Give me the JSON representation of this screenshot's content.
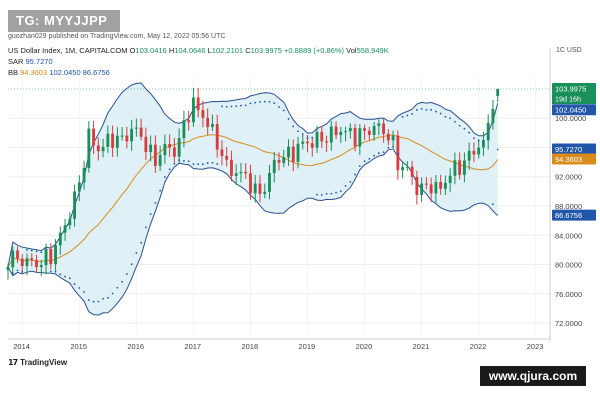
{
  "badge": "TG: MYYJJPP",
  "published": "guozhan029 published on TradingView.com, May 12, 2022 05:56 UTC",
  "header": {
    "symbol": "US Dollar Index, 1M, CAPITALCOM",
    "open_label": "O",
    "open": "103.0416",
    "high_label": "H",
    "high": "104.0646",
    "low_label": "L",
    "low": "102.2101",
    "close_label": "C",
    "close": "103.9975",
    "change": "+0.8889 (+0.86%)",
    "vol_label": "Vol",
    "vol": "558.949K",
    "sar_label": "SAR",
    "sar": "95.7270",
    "bb_label": "BB",
    "bb_mid": "94.3603",
    "bb_upper": "102.0450",
    "bb_lower": "86.6756"
  },
  "currency": "1C USD",
  "price_tags": {
    "close": "103.9975",
    "countdown": "19d 16h",
    "bb_upper": "102.0450",
    "sar": "95.7270",
    "bb_mid": "94.3603",
    "bb_lower": "86.6756"
  },
  "colors": {
    "up": "#1a8f5a",
    "down": "#d93c3c",
    "sar": "#2156a8",
    "bb_mid": "#d98b1c",
    "bb_band": "#2b4f8c",
    "bb_fill": "#dff0f6",
    "close_tag": "#1a8f5a",
    "upper_tag": "#2156a8",
    "sar_tag": "#2156a8",
    "mid_tag": "#d98b1c"
  },
  "footer": {
    "tradingview": "TradingView",
    "logo_icon": "tradingview-logo-icon"
  },
  "watermark": "www.qjura.com",
  "chart_data": {
    "type": "candlestick",
    "title": "US Dollar Index, 1M, CAPITALCOM",
    "x_ticks": [
      "2014",
      "2015",
      "2016",
      "2017",
      "2018",
      "2019",
      "2020",
      "2021",
      "2022",
      "2023"
    ],
    "y_ticks": [
      "72.0000",
      "76.0000",
      "80.0000",
      "84.0000",
      "88.0000",
      "92.0000",
      "96.0000",
      "100.0000"
    ],
    "ylim": [
      70.5,
      105.5
    ],
    "x_range": [
      2013.75,
      2023.25
    ],
    "anchors": [
      [
        2013.75,
        81.0
      ],
      [
        2014.0,
        80.6
      ],
      [
        2014.25,
        80.1
      ],
      [
        2014.4,
        80.6
      ],
      [
        2014.55,
        81.7
      ],
      [
        2014.67,
        84.0
      ],
      [
        2014.83,
        86.9
      ],
      [
        2015.0,
        91.2
      ],
      [
        2015.17,
        97.5
      ],
      [
        2015.35,
        95.6
      ],
      [
        2015.55,
        97.3
      ],
      [
        2015.75,
        97.0
      ],
      [
        2015.95,
        98.7
      ],
      [
        2016.12,
        97.2
      ],
      [
        2016.3,
        94.0
      ],
      [
        2016.5,
        96.0
      ],
      [
        2016.7,
        95.5
      ],
      [
        2016.85,
        99.5
      ],
      [
        2016.98,
        102.1
      ],
      [
        2017.2,
        100.0
      ],
      [
        2017.4,
        97.0
      ],
      [
        2017.6,
        93.0
      ],
      [
        2017.75,
        92.6
      ],
      [
        2017.95,
        91.9
      ],
      [
        2018.1,
        89.5
      ],
      [
        2018.25,
        90.5
      ],
      [
        2018.45,
        94.5
      ],
      [
        2018.7,
        95.0
      ],
      [
        2018.9,
        96.5
      ],
      [
        2019.1,
        96.8
      ],
      [
        2019.35,
        97.5
      ],
      [
        2019.6,
        98.5
      ],
      [
        2019.8,
        97.5
      ],
      [
        2020.0,
        98.0
      ],
      [
        2020.2,
        99.0
      ],
      [
        2020.45,
        97.5
      ],
      [
        2020.6,
        93.5
      ],
      [
        2020.75,
        93.0
      ],
      [
        2020.95,
        90.0
      ],
      [
        2021.15,
        91.0
      ],
      [
        2021.3,
        90.0
      ],
      [
        2021.5,
        92.5
      ],
      [
        2021.75,
        94.0
      ],
      [
        2021.95,
        96.0
      ],
      [
        2022.1,
        96.5
      ],
      [
        2022.25,
        102.5
      ],
      [
        2022.33,
        104.0
      ]
    ],
    "bollinger": {
      "period": 20,
      "std_dev": 2,
      "latest": {
        "upper": 102.045,
        "middle": 94.3603,
        "lower": 86.6756
      }
    },
    "parabolic_sar": {
      "latest": 95.727
    },
    "last_candle": {
      "open": 103.0416,
      "high": 104.0646,
      "low": 102.2101,
      "close": 103.9975
    },
    "volume": "558.949K",
    "grid": true,
    "price_axis": "right"
  }
}
